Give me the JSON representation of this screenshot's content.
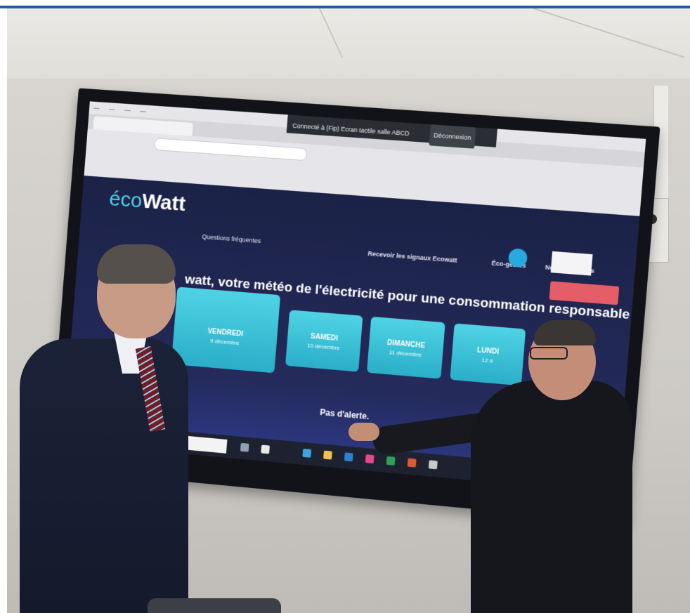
{
  "photo": {
    "screen_site": {
      "logo_eco": "éco",
      "logo_watt": "Watt",
      "nav": {
        "faq": "Questions fréquentes",
        "signals": "Recevoir les signaux Ecowatt",
        "gestes": "Éco-gestes",
        "partners": "Nos partenaires"
      },
      "headline": "watt, votre météo de l'électricité pour une consommation responsable",
      "days": [
        {
          "day": "VENDREDI",
          "date": "9 décembre"
        },
        {
          "day": "SAMEDI",
          "date": "10 décembre"
        },
        {
          "day": "DIMANCHE",
          "date": "11 décembre"
        },
        {
          "day": "LUNDI",
          "date": "12 d"
        }
      ],
      "status": "Pas d'alerte."
    },
    "share_banner": {
      "text": "Connecté à (Fip) Ecran tactile salle ABCD",
      "button": "Déconnexion"
    },
    "colors": {
      "frame_rule": "#1f5fa8",
      "site_bg": "#1b2247",
      "card": "#2aaec9",
      "alert_button": "#e55d67"
    }
  }
}
